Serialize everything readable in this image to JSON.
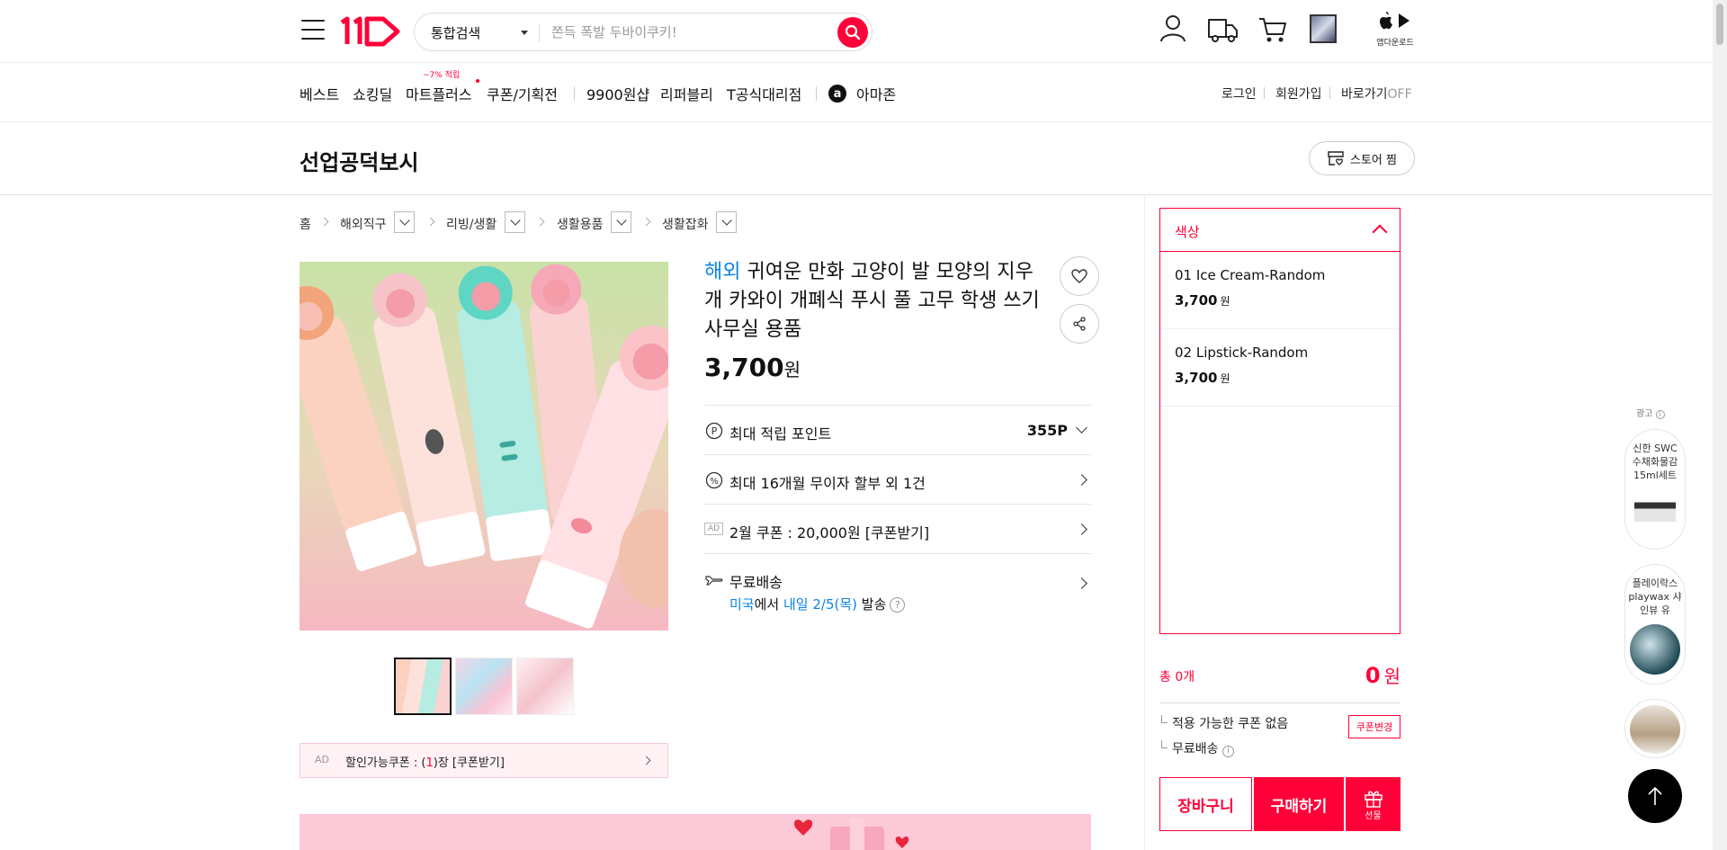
{
  "header": {
    "search_scope": "통합검색",
    "search_placeholder": "쫀득 폭발 두바이쿠키!",
    "app_download_label": "앱다운로드"
  },
  "nav": {
    "items": [
      "베스트",
      "쇼킹딜",
      "마트플러스",
      "쿠폰/기획전",
      "9900원샵",
      "리퍼블리",
      "T공식대리점",
      "아마존"
    ],
    "promo_badge": "~7% 적립",
    "login": "로그인",
    "signup": "회원가입",
    "shortcut": "바로가기",
    "shortcut_state": "OFF"
  },
  "store": {
    "name": "선업공덕보시",
    "follow_label": "스토어 찜"
  },
  "breadcrumb": [
    "홈",
    "해외직구",
    "리빙/생활",
    "생활용품",
    "생활잡화"
  ],
  "product": {
    "tag": "해외",
    "title": "귀여운 만화 고양이 발 모양의 지우개 카와이 개폐식 푸시 풀 고무 학생 쓰기 사무실 용품",
    "price": "3,700",
    "price_unit": "원",
    "points_label": "최대 적립 포인트",
    "points_value": "355P",
    "installment_label": "최대 16개월 무이자 할부 외 1건",
    "coupon_ad_tag": "AD",
    "coupon_label": "2월 쿠폰 : 20,000원 [쿠폰받기]",
    "shipping_label": "무료배송",
    "shipping_origin": "미국",
    "shipping_from": "에서 ",
    "shipping_date": "내일 2/5(목)",
    "shipping_suffix": " 발송",
    "shipping_help": "?"
  },
  "discount_coupon": {
    "ad": "AD",
    "prefix": "할인가능쿠폰 : (",
    "count": "1",
    "suffix": ")장 [쿠폰받기]"
  },
  "options": {
    "header": "색상",
    "items": [
      {
        "name": "01 Ice Cream-Random",
        "price": "3,700",
        "unit": "원"
      },
      {
        "name": "02 Lipstick-Random",
        "price": "3,700",
        "unit": "원"
      }
    ]
  },
  "order": {
    "total_label": "총 0개",
    "total_amount": "0",
    "total_unit": "원",
    "coupon_note": "적용 가능한 쿠폰 없음",
    "coupon_change": "쿠폰변경",
    "shipping_note": "무료배송",
    "cart_button": "장바구니",
    "buy_button": "구매하기",
    "gift_button": "선물"
  },
  "side_ads": {
    "label": "광고",
    "cards": [
      {
        "title": "신한 SWC 수채화물감 15ml세트"
      },
      {
        "title": "플레이락스 playwax 샤인뷰 유"
      }
    ]
  },
  "colors": {
    "brand": "#ff0038",
    "link_blue": "#0b83e6"
  }
}
